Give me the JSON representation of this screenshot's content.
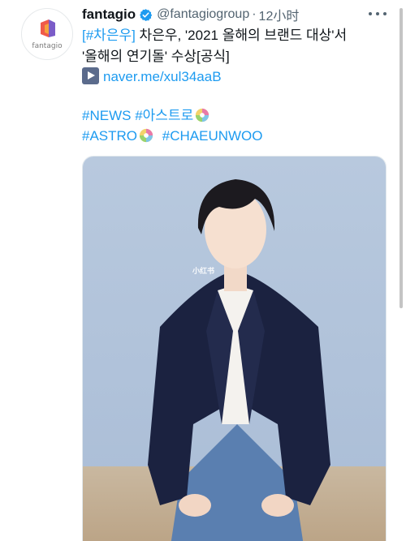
{
  "tweet": {
    "author_name": "fantagio",
    "author_handle": "@fantagiogroup",
    "separator": "·",
    "time": "12小时",
    "avatar_text": "fantagio",
    "line1_tag": "[#차은우]",
    "line1_text": " 차은우, '2021 올해의 브랜드 대상'서",
    "line2_text": "'올해의 연기돌' 수상[공식]",
    "link_text": "naver.me/xul34aaB",
    "hashtag_news": "#NEWS",
    "hashtag_astro_kr": "#아스트로",
    "hashtag_astro": "#ASTRO",
    "hashtag_chaeunwoo": "#CHAEUNWOO",
    "media_watermark": "小红书"
  },
  "colors": {
    "link_blue": "#1d9bf0",
    "text_dark": "#0f1419",
    "text_gray": "#536471",
    "photo_background": "#b4c6dc",
    "blazer_navy": "#1b2240"
  },
  "icons": {
    "verified": "verified-badge-icon",
    "more": "more-dots-icon",
    "link": "play-link-icon",
    "emoji": "astro-emoji-icon"
  }
}
